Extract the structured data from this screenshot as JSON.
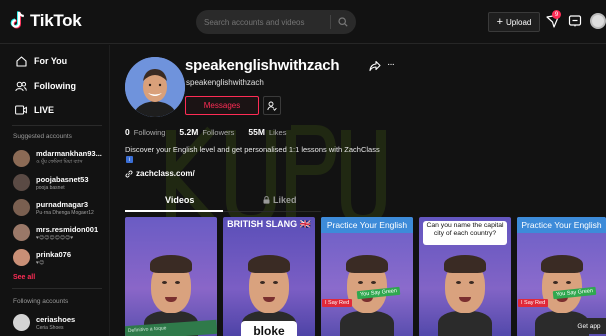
{
  "header": {
    "logo_text": "TikTok",
    "search_placeholder": "Search accounts and videos",
    "upload_label": "Upload",
    "inbox_badge": "9"
  },
  "sidebar": {
    "nav": [
      {
        "label": "For You",
        "icon": "home-icon"
      },
      {
        "label": "Following",
        "icon": "users-icon"
      },
      {
        "label": "LIVE",
        "icon": "live-icon"
      }
    ],
    "suggested_heading": "Suggested accounts",
    "suggested": [
      {
        "name": "mdarmankhan93...",
        "sub": "ও মুঁয় ফেমিদা মিয়া ব্যাস"
      },
      {
        "name": "poojabasnet53",
        "sub": "pooja basnet"
      },
      {
        "name": "purnadmagar3",
        "sub": "Pu·rna Dhenga Mogaer12"
      },
      {
        "name": "mrs.resmidon001",
        "sub": "♥😊😊😊😊😊😊♥"
      },
      {
        "name": "prinka076",
        "sub": "♥😊"
      }
    ],
    "see_all": "See all",
    "following_heading": "Following accounts",
    "following": [
      {
        "name": "ceriashoes",
        "sub": "Ceria Shoes"
      }
    ]
  },
  "profile": {
    "username": "speakenglishwithzach",
    "handle": "speakenglishwithzach",
    "message_label": "Messages",
    "following_count": "0",
    "following_label": "Following",
    "followers_count": "5.2M",
    "followers_label": "Followers",
    "likes_count": "55M",
    "likes_label": "Likes",
    "bio": "Discover your English level and get personalised 1:1 lessons with ZachClass",
    "bio_badge": "i",
    "link": "zachclass.com/"
  },
  "tabs": {
    "videos": "Videos",
    "liked": "Liked"
  },
  "videos": [
    {
      "caption": "",
      "overlay": "Definitivo a toque"
    },
    {
      "caption": "BRITISH SLANG 🇬🇧",
      "card": "bloke"
    },
    {
      "caption": "Practice Your English",
      "tag_red": "I Say Red",
      "tag_green": "You Say Green"
    },
    {
      "caption": "Can you name the capital city of each country?"
    },
    {
      "caption": "Practice Your English",
      "tag_red": "I Say Red",
      "tag_green": "You Say Green"
    }
  ],
  "get_app": "Get app"
}
